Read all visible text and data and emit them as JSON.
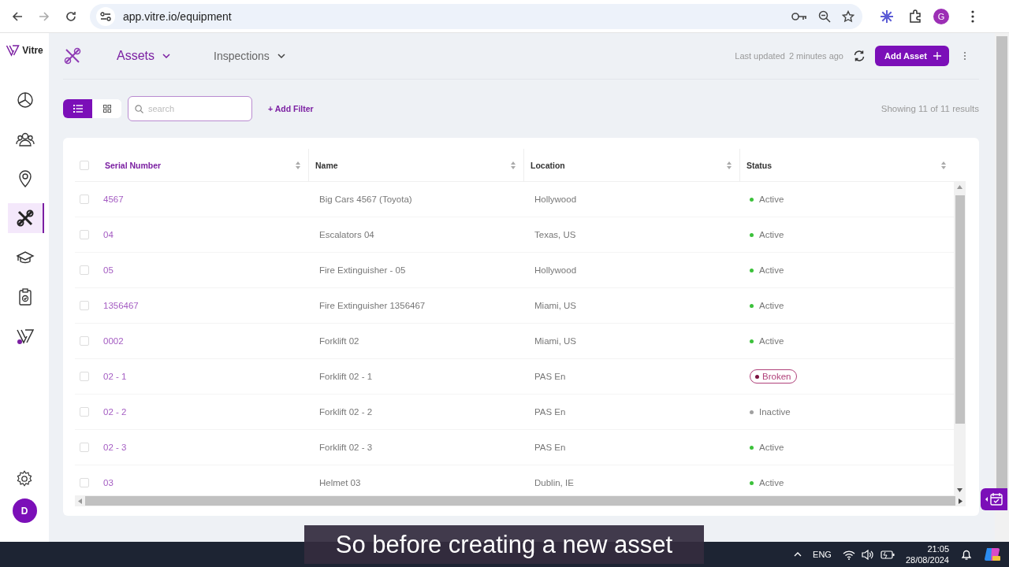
{
  "browser": {
    "url": "app.vitre.io/equipment",
    "profile_initial": "G"
  },
  "sidebar": {
    "logo": "Vitre",
    "items": [
      {
        "selected": false
      },
      {
        "selected": false
      },
      {
        "selected": false
      },
      {
        "selected": true
      },
      {
        "selected": false
      },
      {
        "selected": false
      },
      {
        "selected": false
      }
    ],
    "avatar": "D"
  },
  "header": {
    "tabs": [
      {
        "label": "Assets",
        "selected": true
      },
      {
        "label": "Inspections",
        "selected": false
      }
    ],
    "last_updated_label": "Last updated",
    "last_updated_value": "2 minutes ago",
    "add_button": "Add Asset"
  },
  "toolbar": {
    "views": [
      {
        "selected": true
      },
      {
        "selected": false
      }
    ],
    "search": {
      "placeholder": "search"
    },
    "add_filter": "+ Add Filter",
    "results": "Showing 11 of 11 results"
  },
  "table": {
    "select_all_checked": false,
    "columns": [
      {
        "label": "Serial Number",
        "active": true
      },
      {
        "label": "Name",
        "active": false
      },
      {
        "label": "Location",
        "active": false
      },
      {
        "label": "Status",
        "active": false
      }
    ],
    "rows": [
      {
        "checked": false,
        "serial": "4567",
        "name": "Big Cars 4567 (Toyota)",
        "location": "Hollywood",
        "status": {
          "label": "Active",
          "kind": "dot",
          "color": "#3cc13b"
        }
      },
      {
        "checked": false,
        "serial": "04",
        "name": "Escalators 04",
        "location": "Texas, US",
        "status": {
          "label": "Active",
          "kind": "dot",
          "color": "#3cc13b"
        }
      },
      {
        "checked": false,
        "serial": "05",
        "name": "Fire Extinguisher - 05",
        "location": "Hollywood",
        "status": {
          "label": "Active",
          "kind": "dot",
          "color": "#3cc13b"
        }
      },
      {
        "checked": false,
        "serial": "1356467",
        "name": "Fire Extinguisher 1356467",
        "location": "Miami, US",
        "status": {
          "label": "Active",
          "kind": "dot",
          "color": "#3cc13b"
        }
      },
      {
        "checked": false,
        "serial": "0002",
        "name": "Forklift 02",
        "location": "Miami, US",
        "status": {
          "label": "Active",
          "kind": "dot",
          "color": "#3cc13b"
        }
      },
      {
        "checked": false,
        "serial": "02 - 1",
        "name": "Forklift 02 - 1",
        "location": "PAS En",
        "status": {
          "label": "Broken",
          "kind": "pill",
          "color": "#7a1240"
        }
      },
      {
        "checked": false,
        "serial": "02 - 2",
        "name": "Forklift 02 - 2",
        "location": "PAS En",
        "status": {
          "label": "Inactive",
          "kind": "dot",
          "color": "#a0a0a0"
        }
      },
      {
        "checked": false,
        "serial": "02 - 3",
        "name": "Forklift 02 - 3",
        "location": "PAS En",
        "status": {
          "label": "Active",
          "kind": "dot",
          "color": "#3cc13b"
        }
      },
      {
        "checked": false,
        "serial": "03",
        "name": "Helmet 03",
        "location": "Dublin, IE",
        "status": {
          "label": "Active",
          "kind": "dot",
          "color": "#3cc13b"
        }
      }
    ]
  },
  "taskbar": {
    "language": "ENG",
    "time": "21:05",
    "date": "28/08/2024"
  },
  "caption": "So before creating a new asset"
}
